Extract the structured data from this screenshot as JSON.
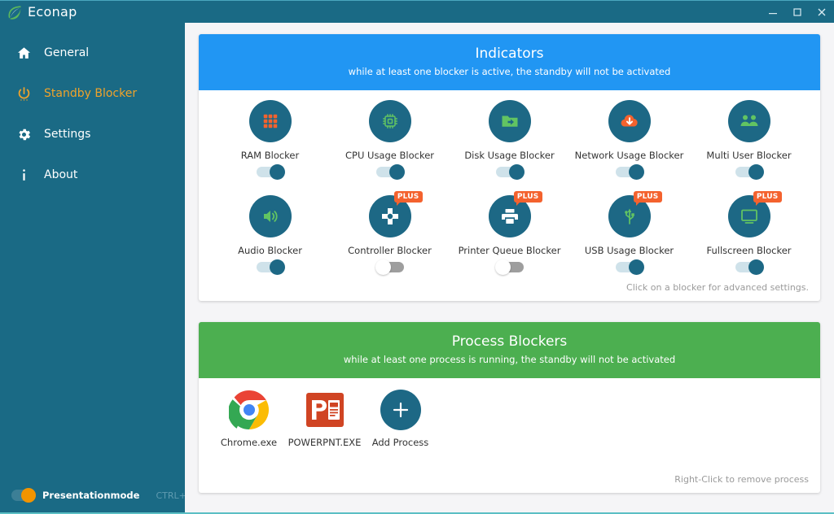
{
  "window": {
    "app_name": "Econap",
    "logo_icon": "leaf-icon",
    "minimize_label": "–",
    "maximize_label": "▭",
    "close_label": "✕"
  },
  "sidebar": {
    "items": [
      {
        "label": "General",
        "icon": "home-icon",
        "active": false
      },
      {
        "label": "Standby Blocker",
        "icon": "power-icon",
        "active": true
      },
      {
        "label": "Settings",
        "icon": "gear-icon",
        "active": false
      },
      {
        "label": "About",
        "icon": "info-icon",
        "active": false
      }
    ],
    "presentation_mode": {
      "label": "Presentationmode",
      "shortcut": "CTRL+ALT+P",
      "state": "on",
      "knob_color": "#f29400"
    }
  },
  "indicators": {
    "title": "Indicators",
    "subtitle": "while at least one blocker is active, the standby will not be activated",
    "header_color": "#2196f3",
    "hint": "Click on a blocker for advanced settings.",
    "rows": [
      [
        {
          "label": "RAM Blocker",
          "icon": "ram-grid-icon",
          "icon_color": "#f4622e",
          "toggle": "on",
          "plus": false
        },
        {
          "label": "CPU Usage Blocker",
          "icon": "cpu-chip-icon",
          "icon_color": "#62c462",
          "toggle": "on",
          "plus": false
        },
        {
          "label": "Disk Usage Blocker",
          "icon": "folder-arrow-icon",
          "icon_color": "#62c462",
          "toggle": "on",
          "plus": false
        },
        {
          "label": "Network Usage Blocker",
          "icon": "cloud-download-icon",
          "icon_color": "#f4622e",
          "toggle": "on",
          "plus": false
        },
        {
          "label": "Multi User Blocker",
          "icon": "users-icon",
          "icon_color": "#62c462",
          "toggle": "on",
          "plus": false
        }
      ],
      [
        {
          "label": "Audio Blocker",
          "icon": "speaker-icon",
          "icon_color": "#62c462",
          "toggle": "on",
          "plus": false
        },
        {
          "label": "Controller Blocker",
          "icon": "gamepad-dpad-icon",
          "icon_color": "#ffffff",
          "toggle": "off",
          "plus": true
        },
        {
          "label": "Printer Queue Blocker",
          "icon": "printer-icon",
          "icon_color": "#ffffff",
          "toggle": "off",
          "plus": true
        },
        {
          "label": "USB Usage Blocker",
          "icon": "usb-icon",
          "icon_color": "#62c462",
          "toggle": "on",
          "plus": true
        },
        {
          "label": "Fullscreen Blocker",
          "icon": "monitor-icon",
          "icon_color": "#62c462",
          "toggle": "on",
          "plus": true
        }
      ]
    ],
    "plus_badge_label": "PLUS",
    "plus_badge_color": "#f4622e"
  },
  "process_blockers": {
    "title": "Process Blockers",
    "subtitle": "while at least one process is running, the standby will not be activated",
    "header_color": "#4caf50",
    "hint": "Right-Click to remove process",
    "items": [
      {
        "label": "Chrome.exe",
        "icon": "chrome-icon"
      },
      {
        "label": "POWERPNT.EXE",
        "icon": "powerpoint-icon"
      },
      {
        "label": "Add Process",
        "icon": "plus-icon"
      }
    ]
  }
}
